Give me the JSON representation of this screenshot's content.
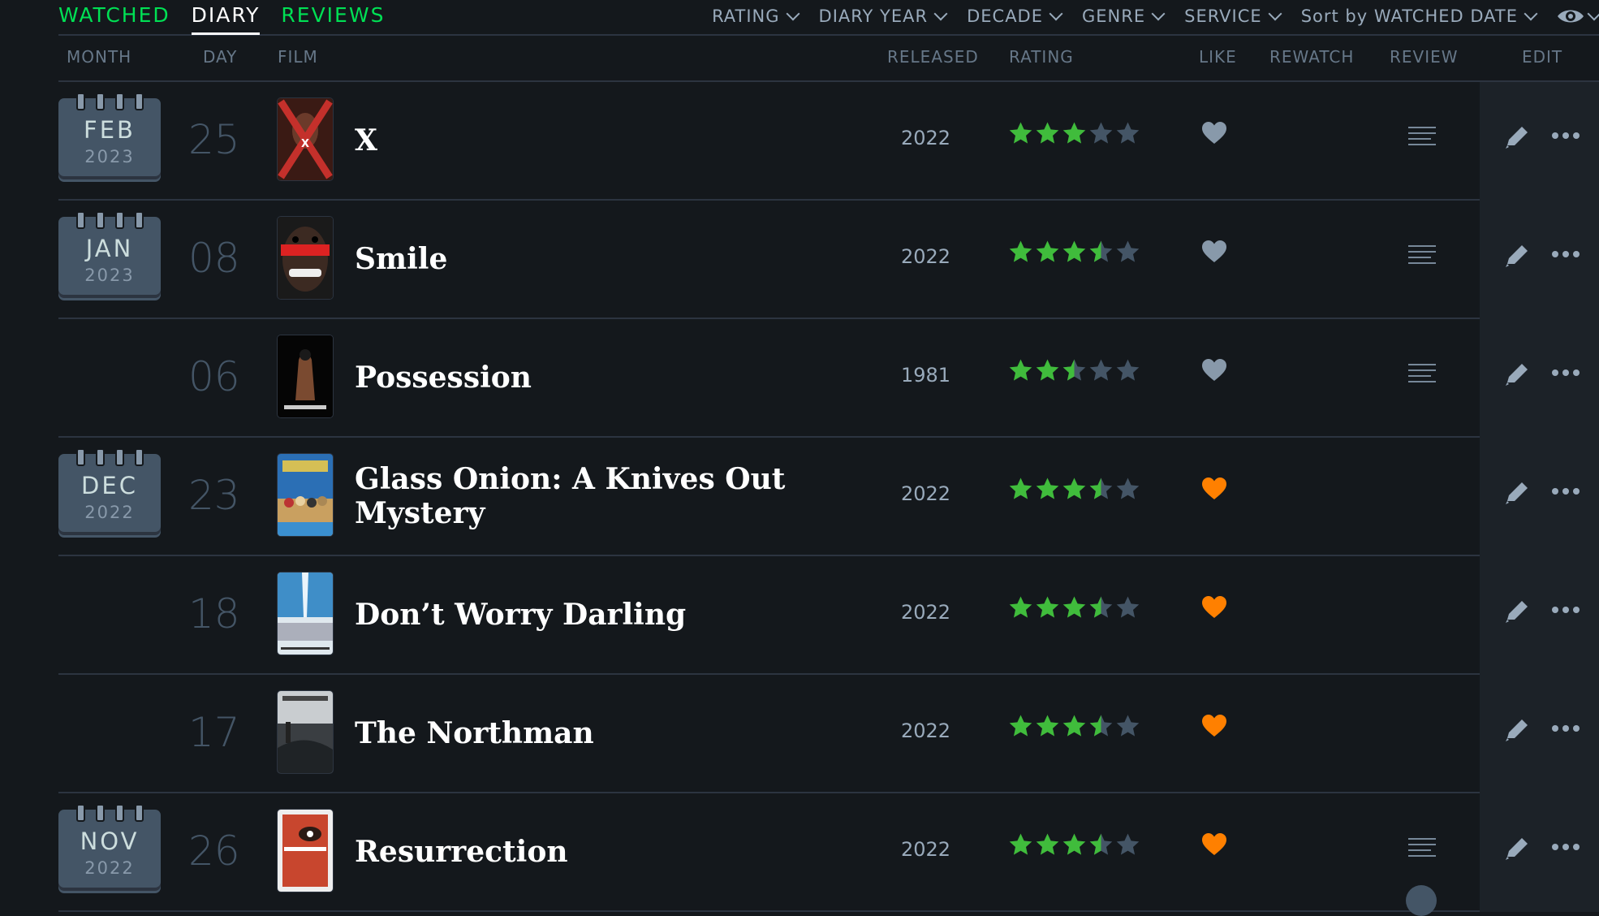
{
  "tabs": [
    {
      "label": "WATCHED",
      "active": false
    },
    {
      "label": "DIARY",
      "active": true
    },
    {
      "label": "REVIEWS",
      "active": false
    }
  ],
  "filters": [
    "RATING",
    "DIARY YEAR",
    "DECADE",
    "GENRE",
    "SERVICE",
    "Sort by WATCHED DATE"
  ],
  "columns": {
    "month": "MONTH",
    "day": "DAY",
    "film": "FILM",
    "released": "RELEASED",
    "rating": "RATING",
    "like": "LIKE",
    "rewatch": "REWATCH",
    "review": "REVIEW",
    "edit": "EDIT"
  },
  "colors": {
    "accent_green": "#00e054",
    "star_green": "#40bc3c",
    "heart_orange": "#ff8000",
    "heart_grey": "#8899aa"
  },
  "entries": [
    {
      "month": "FEB",
      "year": "2023",
      "day": "25",
      "title": "X",
      "released": "2022",
      "rating": 3,
      "liked": false,
      "review": true
    },
    {
      "month": "JAN",
      "year": "2023",
      "day": "08",
      "title": "Smile",
      "released": "2022",
      "rating": 3.5,
      "liked": false,
      "review": true
    },
    {
      "month": "",
      "year": "",
      "day": "06",
      "title": "Possession",
      "released": "1981",
      "rating": 2.5,
      "liked": false,
      "review": true
    },
    {
      "month": "DEC",
      "year": "2022",
      "day": "23",
      "title": "Glass Onion: A Knives Out Mystery",
      "released": "2022",
      "rating": 3.5,
      "liked": true,
      "review": false
    },
    {
      "month": "",
      "year": "",
      "day": "18",
      "title": "Don’t Worry Darling",
      "released": "2022",
      "rating": 3.5,
      "liked": true,
      "review": false
    },
    {
      "month": "",
      "year": "",
      "day": "17",
      "title": "The Northman",
      "released": "2022",
      "rating": 3.5,
      "liked": true,
      "review": false
    },
    {
      "month": "NOV",
      "year": "2022",
      "day": "26",
      "title": "Resurrection",
      "released": "2022",
      "rating": 3.5,
      "liked": true,
      "review": true
    }
  ],
  "icons": {
    "chevron": "chevron-down-icon",
    "eye": "eye-icon",
    "heart": "heart-icon",
    "review": "review-lines-icon",
    "edit": "pencil-icon",
    "more": "more-icon",
    "calendar": "calendar-icon",
    "star": "star-icon"
  }
}
